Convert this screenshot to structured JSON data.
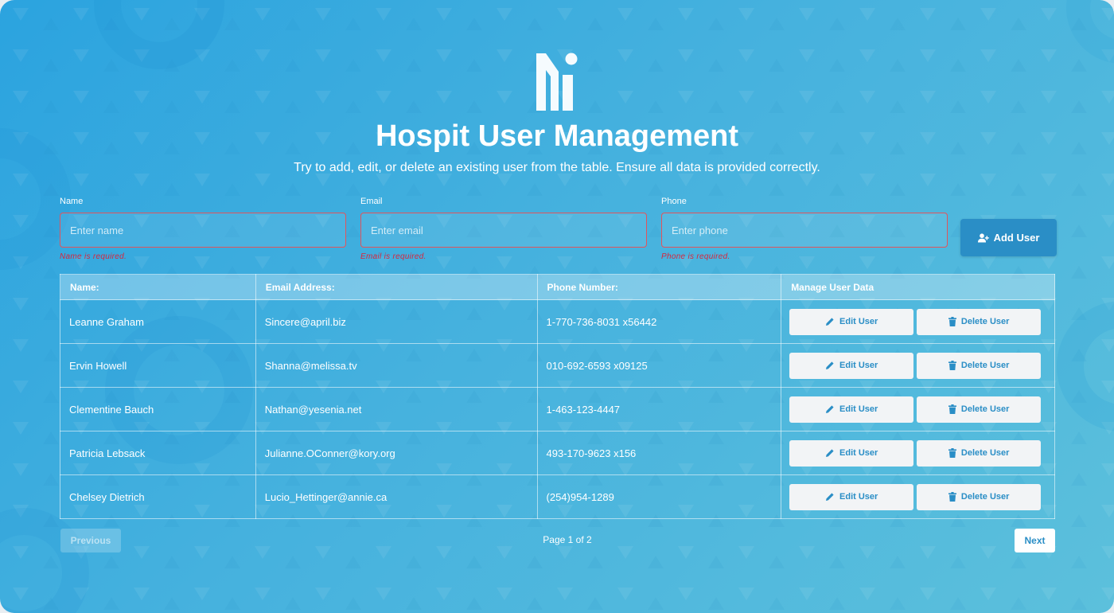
{
  "app": {
    "title": "Hospit User Management",
    "subtitle": "Try to add, edit, or delete an existing user from the table. Ensure all data is provided correctly."
  },
  "form": {
    "name": {
      "label": "Name",
      "placeholder": "Enter name",
      "value": "",
      "error": "Name is required."
    },
    "email": {
      "label": "Email",
      "placeholder": "Enter email",
      "value": "",
      "error": "Email is required."
    },
    "phone": {
      "label": "Phone",
      "placeholder": "Enter phone",
      "value": "",
      "error": "Phone is required."
    },
    "add_button_label": "Add User",
    "add_button_icon": "user-plus-icon"
  },
  "table": {
    "headers": [
      "Name:",
      "Email Address:",
      "Phone Number:",
      "Manage User Data"
    ],
    "rows": [
      {
        "name": "Leanne Graham",
        "email": "Sincere@april.biz",
        "phone": "1-770-736-8031 x56442"
      },
      {
        "name": "Ervin Howell",
        "email": "Shanna@melissa.tv",
        "phone": "010-692-6593 x09125"
      },
      {
        "name": "Clementine Bauch",
        "email": "Nathan@yesenia.net",
        "phone": "1-463-123-4447"
      },
      {
        "name": "Patricia Lebsack",
        "email": "Julianne.OConner@kory.org",
        "phone": "493-170-9623 x156"
      },
      {
        "name": "Chelsey Dietrich",
        "email": "Lucio_Hettinger@annie.ca",
        "phone": "(254)954-1289"
      }
    ],
    "edit_label": "Edit User",
    "delete_label": "Delete User"
  },
  "pagination": {
    "previous_label": "Previous",
    "next_label": "Next",
    "page_info": "Page 1 of 2"
  },
  "colors": {
    "accent": "#2a8ec6",
    "error": "#d7263d",
    "background_start": "#2ba3df",
    "background_end": "#5cc0dc"
  }
}
